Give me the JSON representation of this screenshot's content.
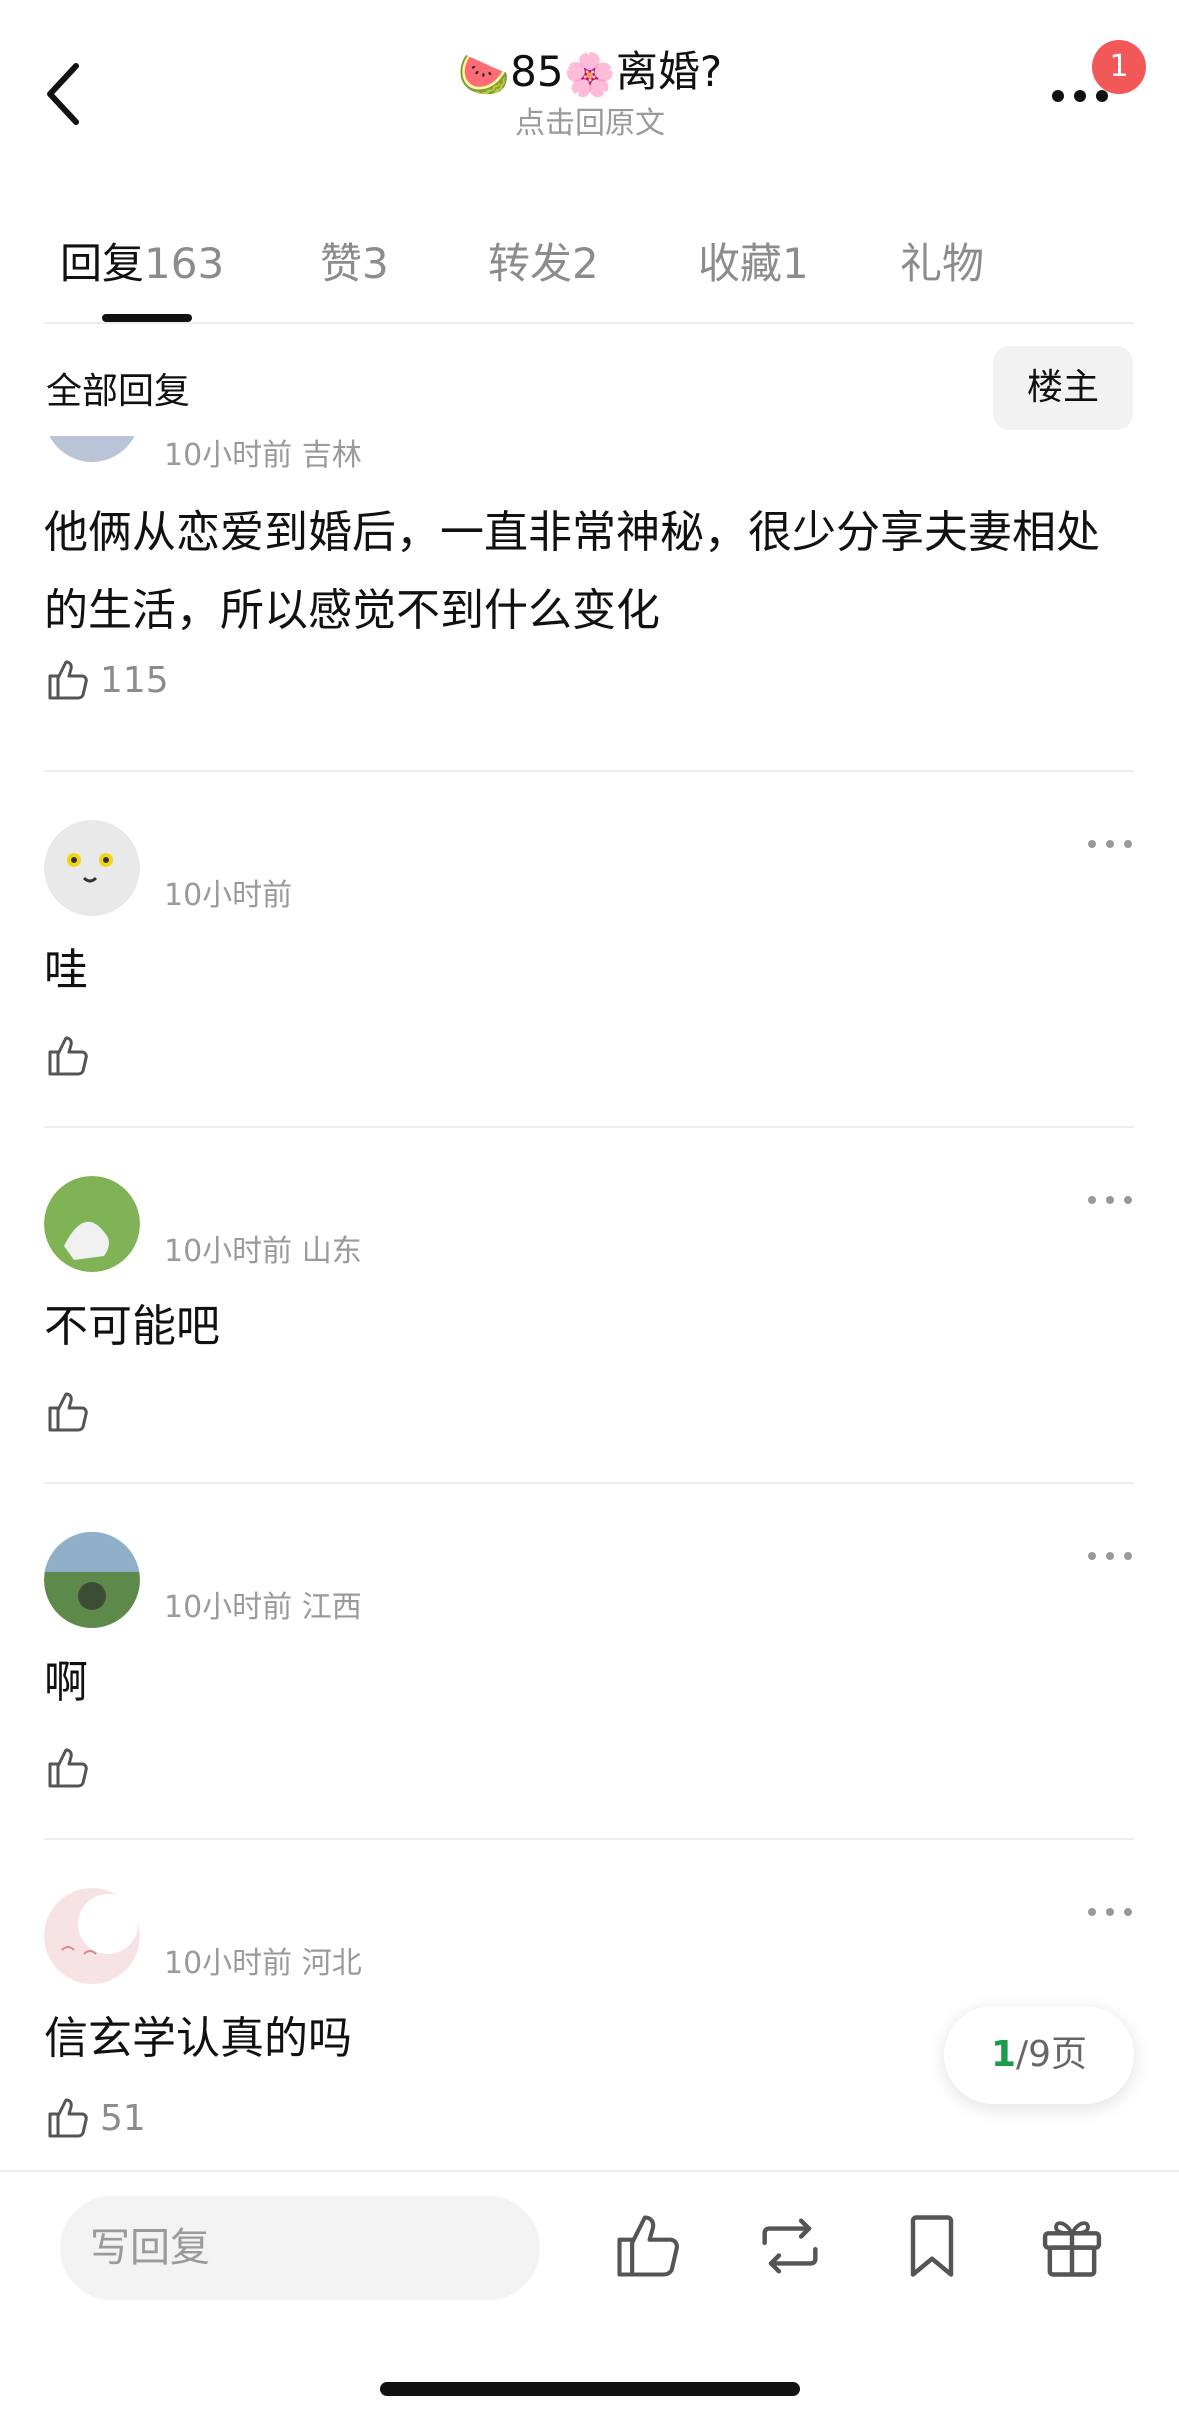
{
  "nav": {
    "title_prefix_emoji": "🍉",
    "title_number": "85",
    "title_mid_emoji": "🌸",
    "title_text": "离婚?",
    "subtitle": "点击回原文",
    "badge": "1"
  },
  "tabs": [
    {
      "label": "回复",
      "count": "163"
    },
    {
      "label": "赞",
      "count": "3"
    },
    {
      "label": "转发",
      "count": "2"
    },
    {
      "label": "收藏",
      "count": "1"
    },
    {
      "label": "礼物",
      "count": ""
    }
  ],
  "filter": {
    "all_replies": "全部回复",
    "owner_only": "楼主"
  },
  "comments": [
    {
      "meta": "10小时前 吉林",
      "text": "他俩从恋爱到婚后，一直非常神秘，很少分享夫妻相处的生活，所以感觉不到什么变化",
      "likes": "115"
    },
    {
      "meta": "10小时前",
      "text": "哇",
      "likes": ""
    },
    {
      "meta": "10小时前 山东",
      "text": "不可能吧",
      "likes": ""
    },
    {
      "meta": "10小时前 江西",
      "text": "啊",
      "likes": ""
    },
    {
      "meta": "10小时前 河北",
      "text": "信玄学认真的吗",
      "likes": "51"
    }
  ],
  "pager": {
    "current": "1",
    "rest": "/9页"
  },
  "bottom": {
    "reply_placeholder": "写回复"
  },
  "colors": {
    "accent_green": "#1c9b4a",
    "badge_red": "#f25858",
    "divider": "#ececec"
  },
  "icons": [
    "back-icon",
    "more-icon",
    "thumbs-up-icon",
    "repost-icon",
    "bookmark-icon",
    "gift-icon"
  ]
}
